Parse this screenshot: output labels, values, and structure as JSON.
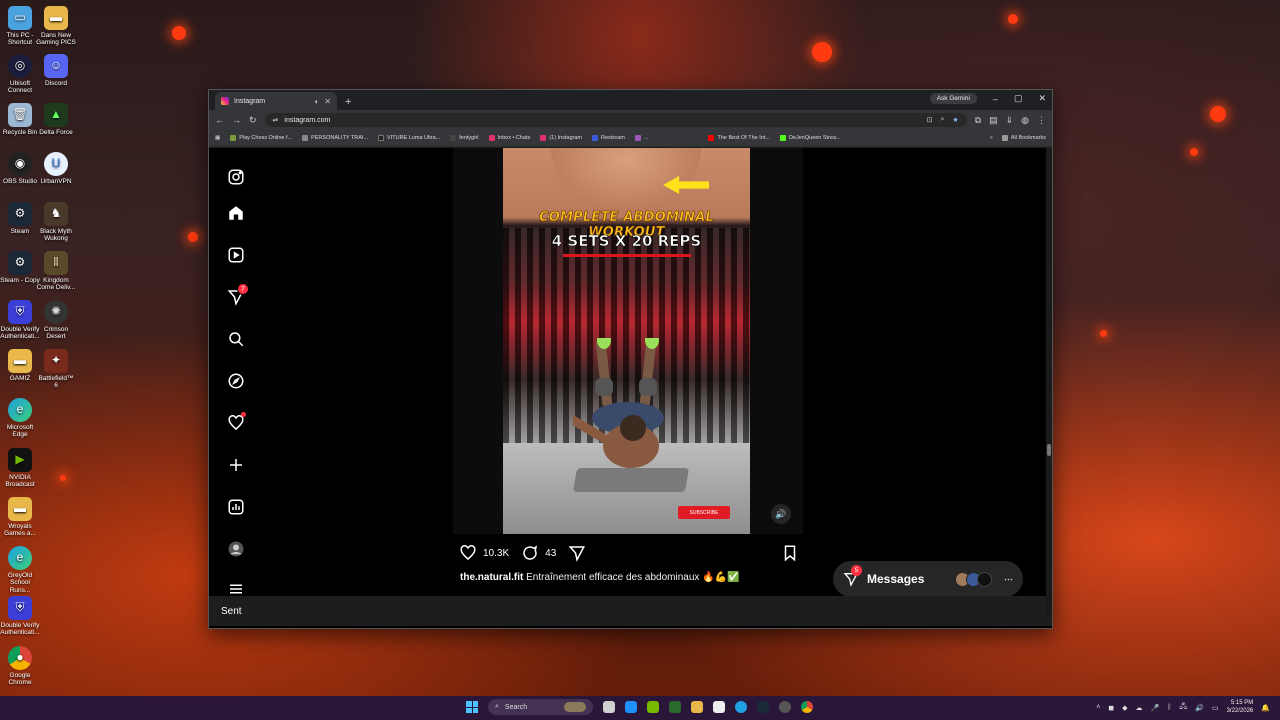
{
  "desktop": {
    "icons": [
      {
        "label": "This PC - Shortcut"
      },
      {
        "label": "Dans New Gaming PICS"
      },
      {
        "label": "Ubisoft Connect"
      },
      {
        "label": "Discord"
      },
      {
        "label": "Recycle Bin"
      },
      {
        "label": "Delta Force"
      },
      {
        "label": "OBS Studio"
      },
      {
        "label": "UrbanVPN"
      },
      {
        "label": "Steam"
      },
      {
        "label": "Black Myth Wukong"
      },
      {
        "label": "Steam - Copy"
      },
      {
        "label": "Kingdom Come Deliv..."
      },
      {
        "label": "Double Verify Authenticati..."
      },
      {
        "label": "Crimson Desert"
      },
      {
        "label": "GAMIZ"
      },
      {
        "label": "Battlefield™ 6"
      },
      {
        "label": "Microsoft Edge"
      },
      {
        "label": "NVIDIA Broadcast"
      },
      {
        "label": "Wroyals Games a..."
      },
      {
        "label": "GreyOld School Runs..."
      },
      {
        "label": "Double Verify Authenticati..."
      },
      {
        "label": "Google Chrome"
      }
    ]
  },
  "browser": {
    "tab_title": "Instagram",
    "ask_gemini": "Ask Gemini",
    "url": "instagram.com",
    "bookmarks": [
      {
        "label": "Play Chess Online f...",
        "color": "#7a9a3a"
      },
      {
        "label": "PERSONALITY TRAI...",
        "color": "#888888"
      },
      {
        "label": "VITURE Luma Ultra...",
        "color": "#222222"
      },
      {
        "label": "fentygirl",
        "color": "#444444"
      },
      {
        "label": "Inbox • Chats",
        "color": "#e1306c"
      },
      {
        "label": "(1) Instagram",
        "color": "#e1306c"
      },
      {
        "label": "Restream",
        "color": "#3b5bdb"
      },
      {
        "label": "...",
        "color": "#9b59b6"
      },
      {
        "label": "The Best Of The Int...",
        "color": "#ff0000"
      },
      {
        "label": "DeJenQueen Strea...",
        "color": "#53fc18"
      }
    ],
    "all_bookmarks": "All Bookmarks"
  },
  "instagram": {
    "nav": [
      {
        "name": "instagram-logo-icon"
      },
      {
        "name": "home-icon"
      },
      {
        "name": "reels-icon"
      },
      {
        "name": "messages-icon"
      },
      {
        "name": "search-icon"
      },
      {
        "name": "explore-icon"
      },
      {
        "name": "notifications-icon"
      },
      {
        "name": "create-icon"
      },
      {
        "name": "dashboard-icon"
      },
      {
        "name": "profile-avatar"
      },
      {
        "name": "menu-icon"
      }
    ],
    "messages_badge": "7",
    "video": {
      "overlay_line1": "COMPLETE ABDOMINAL WORKOUT",
      "overlay_line2": "4 SETS X 20 REPS",
      "subscribe_label": "SUBSCRIBE"
    },
    "likes": "10.3K",
    "comments": "43",
    "caption_user": "the.natural.fit",
    "caption_text": "Entraînement efficace des abdominaux 🔥💪✅",
    "messages_label": "Messages",
    "messages_count": "5",
    "status_text": "Sent"
  },
  "taskbar": {
    "search_label": "Search",
    "time": "5:15 PM",
    "date": "3/22/2026"
  }
}
